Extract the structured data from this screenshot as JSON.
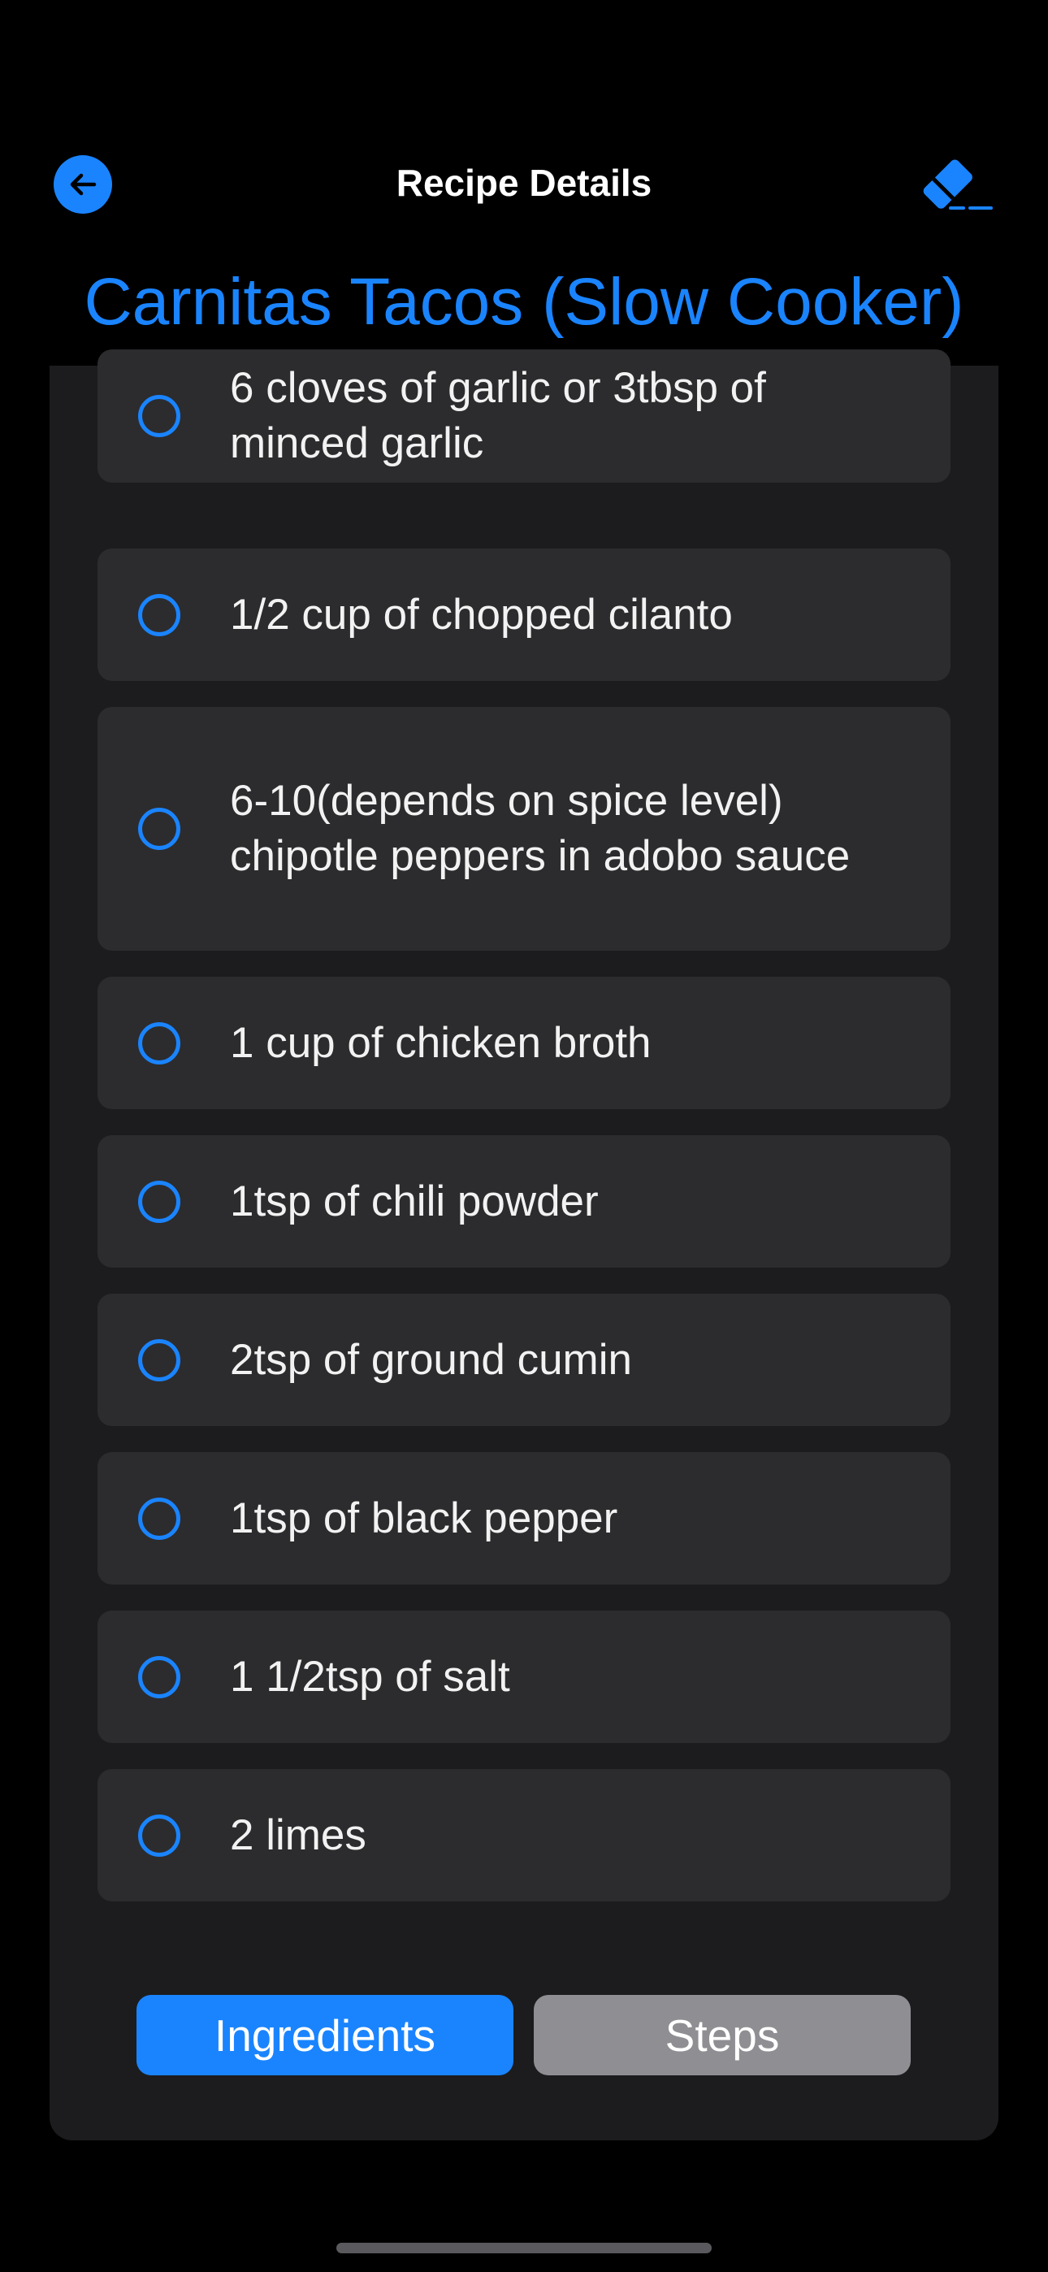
{
  "header": {
    "title": "Recipe Details",
    "back_icon": "arrow-left-icon",
    "clear_icon": "eraser-icon",
    "accent": "#1a84ff"
  },
  "recipe": {
    "title": "Carnitas Tacos (Slow Cooker)"
  },
  "ingredients": [
    {
      "text": "6 cloves of garlic or 3tbsp of minced garlic",
      "checked": false
    },
    {
      "text": "1/2 cup of chopped cilanto",
      "checked": false
    },
    {
      "text": "6-10(depends on spice level) chipotle peppers in adobo sauce",
      "checked": false
    },
    {
      "text": "1 cup of chicken broth",
      "checked": false
    },
    {
      "text": "1tsp of chili powder",
      "checked": false
    },
    {
      "text": "2tsp of ground cumin",
      "checked": false
    },
    {
      "text": "1tsp of black pepper",
      "checked": false
    },
    {
      "text": "1 1/2tsp of salt",
      "checked": false
    },
    {
      "text": "2 limes",
      "checked": false
    }
  ],
  "tabs": {
    "ingredients_label": "Ingredients",
    "steps_label": "Steps",
    "active": "Ingredients"
  }
}
